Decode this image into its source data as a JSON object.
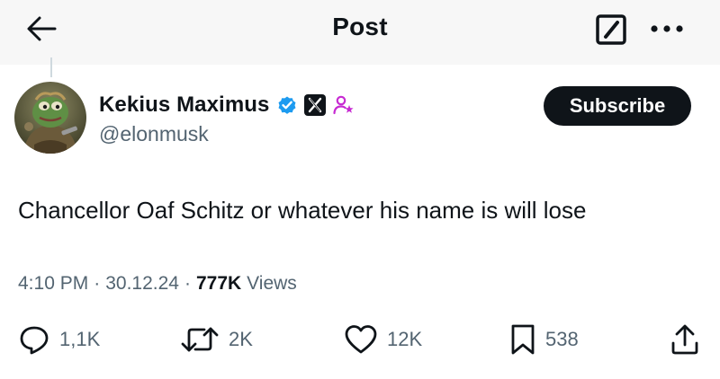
{
  "header": {
    "title": "Post",
    "back_icon": "arrow-left-icon",
    "compose_icon": "compose-icon",
    "more_icon": "more-horizontal-icon"
  },
  "author": {
    "display_name": "Kekius Maximus",
    "handle": "@elonmusk",
    "badges": [
      "verified-badge-icon",
      "x-affiliate-badge-icon",
      "affiliate-person-icon"
    ],
    "verified_color": "#1d9bf0",
    "affiliate_color": "#c72bd2"
  },
  "subscribe_label": "Subscribe",
  "post": {
    "text": "Chancellor Oaf Schitz or whatever his name is will lose",
    "time": "4:10 PM",
    "date": "30.12.24",
    "views_count": "777K",
    "views_label": "Views",
    "separator": "·"
  },
  "actions": {
    "replies": "1,1K",
    "reposts": "2K",
    "likes": "12K",
    "bookmarks": "538"
  },
  "colors": {
    "text": "#0f1419",
    "secondary": "#536471",
    "header_bg": "#f7f7f7"
  }
}
